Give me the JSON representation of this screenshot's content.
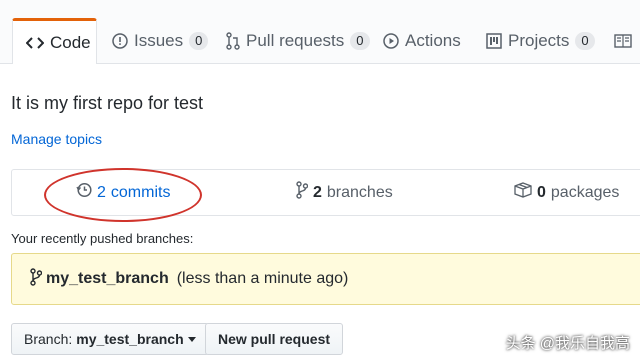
{
  "tabs": [
    {
      "label": "Code",
      "icon": "code-icon",
      "selected": true
    },
    {
      "label": "Issues",
      "count": "0",
      "icon": "issue-icon"
    },
    {
      "label": "Pull requests",
      "count": "0",
      "icon": "pull-request-icon"
    },
    {
      "label": "Actions",
      "icon": "play-icon"
    },
    {
      "label": "Projects",
      "count": "0",
      "icon": "project-icon"
    }
  ],
  "repo": {
    "description": "It is my first repo for test",
    "manage_topics": "Manage topics"
  },
  "summary": {
    "commits_count": "2",
    "commits_label": "commits",
    "branches_count": "2",
    "branches_label": "branches",
    "packages_count": "0",
    "packages_label": "packages"
  },
  "recent_pushes": {
    "heading": "Your recently pushed branches:",
    "branch": "my_test_branch",
    "time": "(less than a minute ago)"
  },
  "branch_select": {
    "prefix": "Branch:",
    "value": "my_test_branch"
  },
  "new_pr_button": "New pull request",
  "watermark": "头条 @我乐自我高",
  "colors": {
    "accent": "#e36209",
    "link": "#0366d6",
    "annotation": "#d0342c",
    "highlight": "#fffbdd"
  }
}
